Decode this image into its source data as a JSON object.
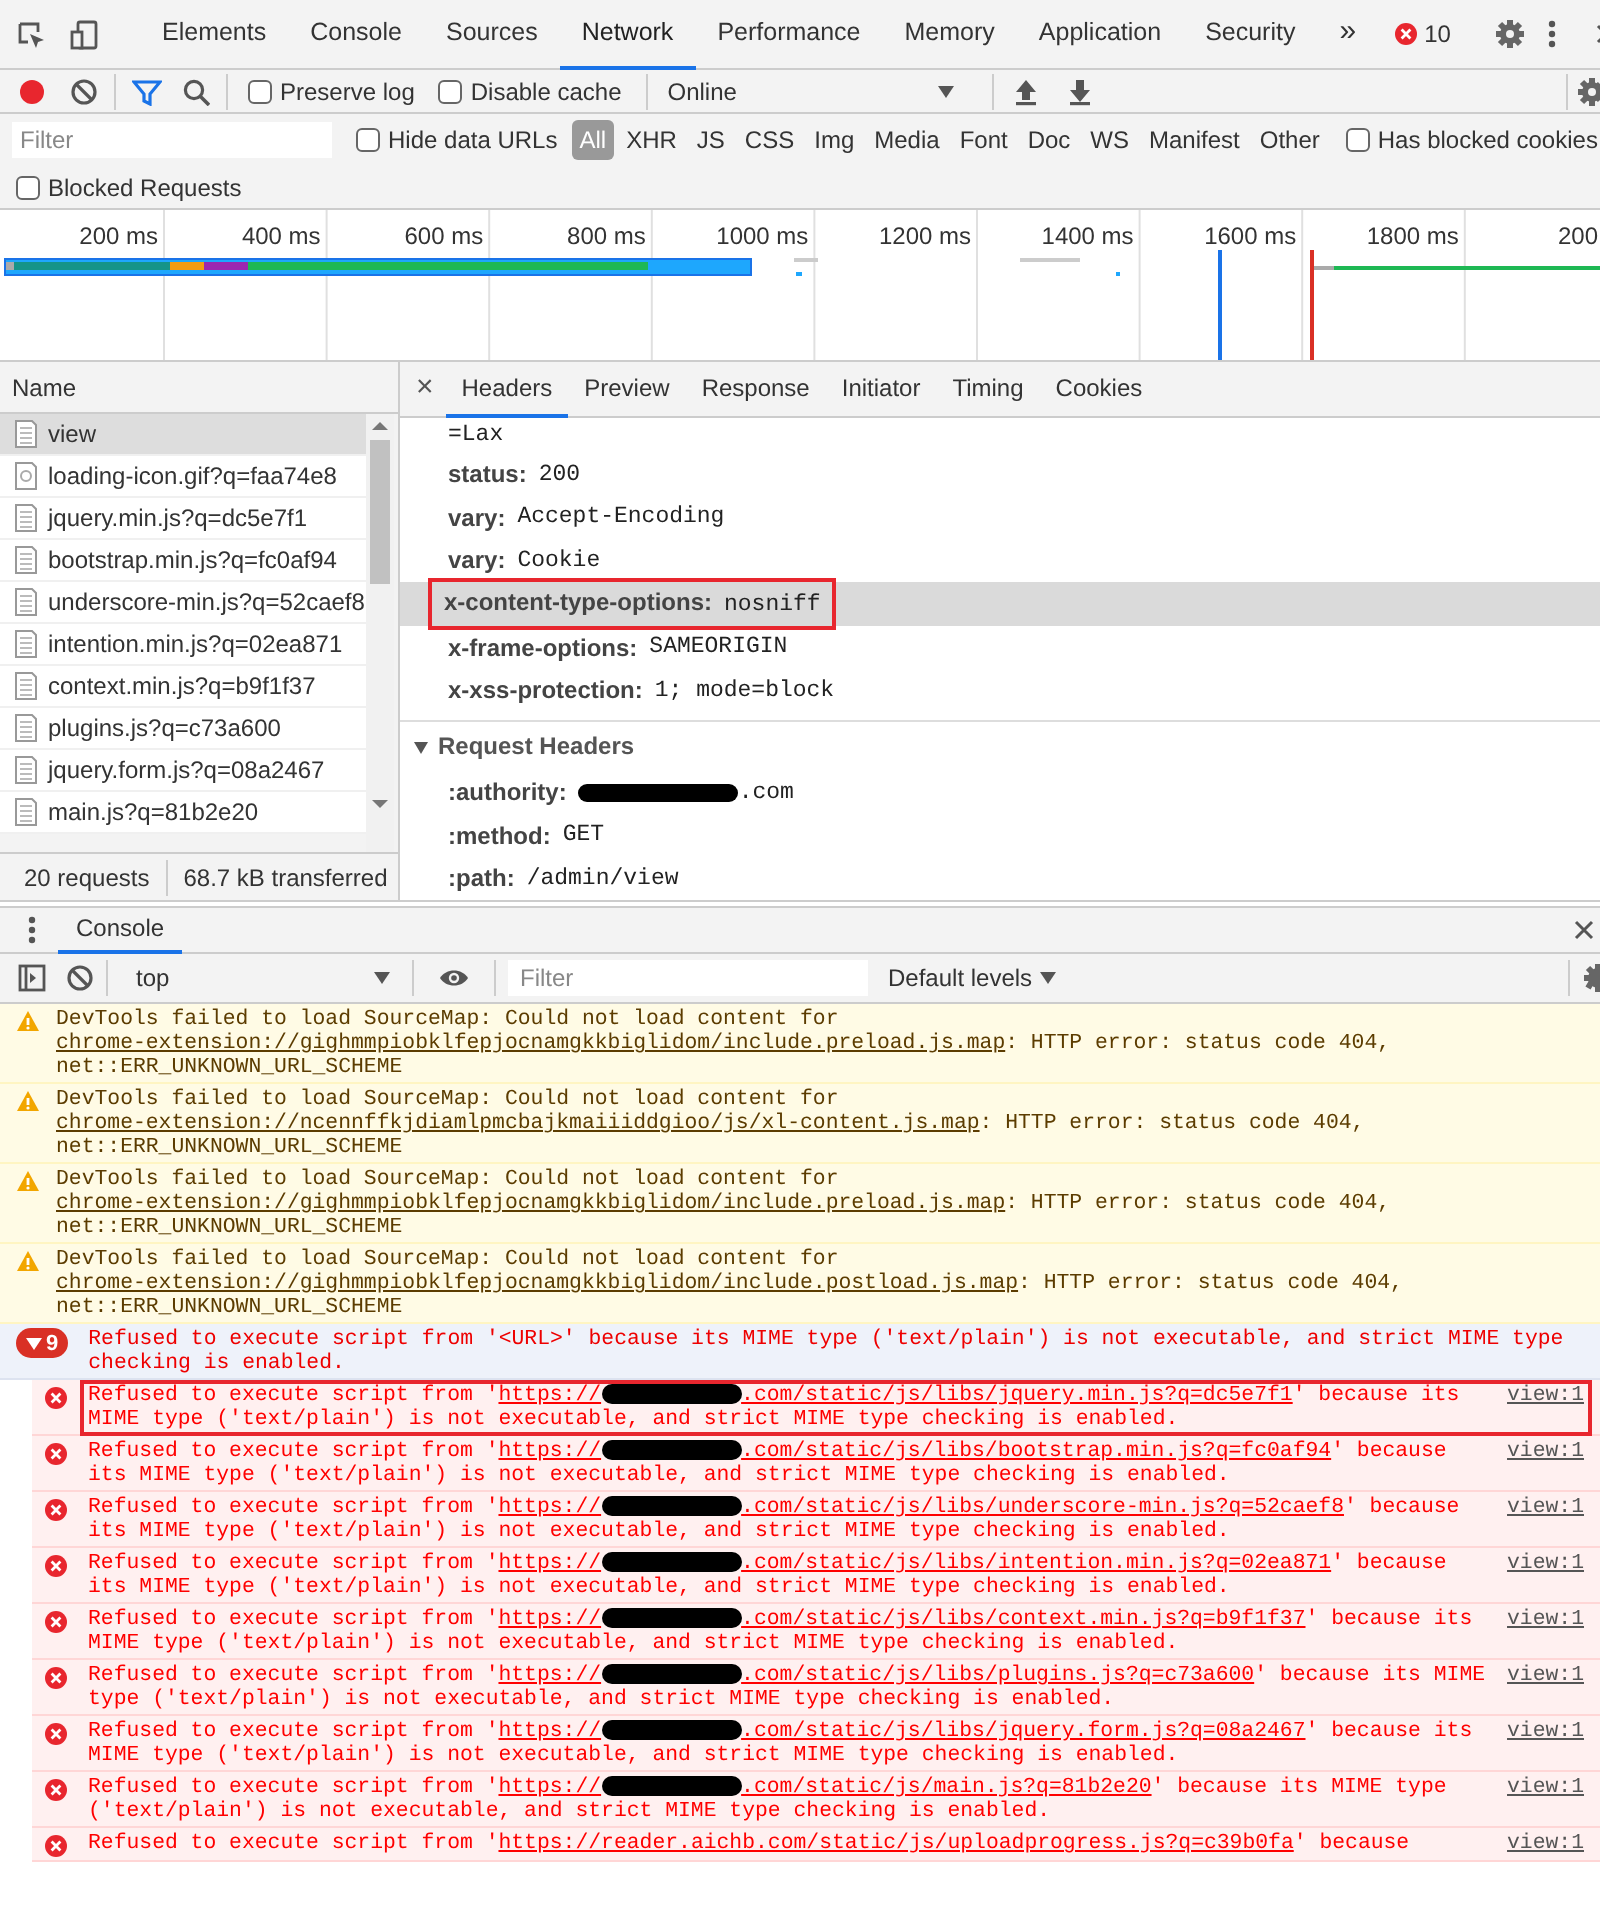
{
  "tabs": [
    {
      "label": "Elements",
      "selected": false
    },
    {
      "label": "Console",
      "selected": false
    },
    {
      "label": "Sources",
      "selected": false
    },
    {
      "label": "Network",
      "selected": true
    },
    {
      "label": "Performance",
      "selected": false
    },
    {
      "label": "Memory",
      "selected": false
    },
    {
      "label": "Application",
      "selected": false
    },
    {
      "label": "Security",
      "selected": false
    }
  ],
  "overflow": "»",
  "error_count": "10",
  "network_toolbar": {
    "recording": true,
    "preserve_log": {
      "label": "Preserve log",
      "checked": false
    },
    "disable_cache": {
      "label": "Disable cache",
      "checked": false
    },
    "throttling": "Online"
  },
  "filter_bar": {
    "placeholder": "Filter",
    "hide_data_urls": {
      "label": "Hide data URLs",
      "checked": false
    },
    "types": [
      {
        "label": "All",
        "selected": true
      },
      {
        "label": "XHR",
        "selected": false
      },
      {
        "label": "JS",
        "selected": false
      },
      {
        "label": "CSS",
        "selected": false
      },
      {
        "label": "Img",
        "selected": false
      },
      {
        "label": "Media",
        "selected": false
      },
      {
        "label": "Font",
        "selected": false
      },
      {
        "label": "Doc",
        "selected": false
      },
      {
        "label": "WS",
        "selected": false
      },
      {
        "label": "Manifest",
        "selected": false
      },
      {
        "label": "Other",
        "selected": false
      }
    ],
    "has_blocked_cookies": {
      "label": "Has blocked cookies",
      "checked": false
    },
    "blocked_requests": {
      "label": "Blocked Requests",
      "checked": false
    }
  },
  "timeline": {
    "ticks": [
      "200 ms",
      "400 ms",
      "600 ms",
      "800 ms",
      "1000 ms",
      "1200 ms",
      "1400 ms",
      "1600 ms",
      "1800 ms",
      "200"
    ]
  },
  "requests": {
    "column": "Name",
    "items": [
      {
        "name": "view",
        "kind": "document",
        "selected": true
      },
      {
        "name": "loading-icon.gif?q=faa74e8",
        "kind": "image",
        "selected": false
      },
      {
        "name": "jquery.min.js?q=dc5e7f1",
        "kind": "document",
        "selected": false
      },
      {
        "name": "bootstrap.min.js?q=fc0af94",
        "kind": "document",
        "selected": false
      },
      {
        "name": "underscore-min.js?q=52caef8",
        "kind": "document",
        "selected": false
      },
      {
        "name": "intention.min.js?q=02ea871",
        "kind": "document",
        "selected": false
      },
      {
        "name": "context.min.js?q=b9f1f37",
        "kind": "document",
        "selected": false
      },
      {
        "name": "plugins.js?q=c73a600",
        "kind": "document",
        "selected": false
      },
      {
        "name": "jquery.form.js?q=08a2467",
        "kind": "document",
        "selected": false
      },
      {
        "name": "main.js?q=81b2e20",
        "kind": "document",
        "selected": false
      }
    ],
    "summary": [
      "20 requests",
      "68.7 kB transferred"
    ]
  },
  "details": {
    "close": "×",
    "tabs": [
      {
        "label": "Headers",
        "selected": true
      },
      {
        "label": "Preview",
        "selected": false
      },
      {
        "label": "Response",
        "selected": false
      },
      {
        "label": "Initiator",
        "selected": false
      },
      {
        "label": "Timing",
        "selected": false
      },
      {
        "label": "Cookies",
        "selected": false
      }
    ],
    "response_lines": [
      {
        "kind": "continuation",
        "value": "=Lax",
        "highlighted": false
      },
      {
        "kind": "header",
        "name": "status:",
        "value": "200",
        "highlighted": false
      },
      {
        "kind": "header",
        "name": "vary:",
        "value": "Accept-Encoding",
        "highlighted": false
      },
      {
        "kind": "header",
        "name": "vary:",
        "value": "Cookie",
        "highlighted": false
      },
      {
        "kind": "header",
        "name": "x-content-type-options:",
        "value": "nosniff",
        "highlighted": true
      },
      {
        "kind": "header",
        "name": "x-frame-options:",
        "value": "SAMEORIGIN",
        "highlighted": false
      },
      {
        "kind": "header",
        "name": "x-xss-protection:",
        "value": "1; mode=block",
        "highlighted": false
      }
    ],
    "request_section": {
      "title": "Request Headers",
      "expanded": true,
      "lines": [
        {
          "name": ":authority:",
          "value": ".com",
          "redacted": true
        },
        {
          "name": ":method:",
          "value": "GET",
          "redacted": false
        },
        {
          "name": ":path:",
          "value": "/admin/view",
          "redacted": false
        }
      ]
    }
  },
  "drawer": {
    "tabs": [
      {
        "label": "Console",
        "selected": true
      }
    ]
  },
  "console_toolbar": {
    "context": "top",
    "filter_placeholder": "Filter",
    "levels": "Default levels"
  },
  "messages": [
    {
      "kind": "warning",
      "text": "DevTools failed to load SourceMap: Could not load content for ",
      "link": "chrome-extension://gighmmpiobklfepjocnamgkkbiglidom/include.preload.js.map",
      "after": ": HTTP error: status code 404, net::ERR_UNKNOWN_URL_SCHEME"
    },
    {
      "kind": "warning",
      "text": "DevTools failed to load SourceMap: Could not load content for ",
      "link": "chrome-extension://ncennffkjdiamlpmcbajkmaiiiddgioo/js/xl-content.js.map",
      "after": ": HTTP error: status code 404, net::ERR_UNKNOWN_URL_SCHEME"
    },
    {
      "kind": "warning",
      "text": "DevTools failed to load SourceMap: Could not load content for ",
      "link": "chrome-extension://gighmmpiobklfepjocnamgkkbiglidom/include.preload.js.map",
      "after": ": HTTP error: status code 404, net::ERR_UNKNOWN_URL_SCHEME"
    },
    {
      "kind": "warning",
      "text": "DevTools failed to load SourceMap: Could not load content for ",
      "link": "chrome-extension://gighmmpiobklfepjocnamgkkbiglidom/include.postload.js.map",
      "after": ": HTTP error: status code 404, net::ERR_UNKNOWN_URL_SCHEME"
    },
    {
      "kind": "group",
      "count": "9",
      "expanded": true,
      "text": "Refused to execute script from '<URL>' because its MIME type ('text/plain') is not executable, and strict MIME type checking is enabled."
    },
    {
      "kind": "error",
      "text": "Refused to execute script from '",
      "url_parts": [
        "https://",
        ".com/static/js/libs/jquery.min.js?q=dc5e7f1"
      ],
      "after": "' because its MIME type ('text/plain') is not executable, and strict MIME type checking is enabled.",
      "source": "view:1",
      "highlighted": true
    },
    {
      "kind": "error",
      "text": "Refused to execute script from '",
      "url_parts": [
        "https://",
        ".com/static/js/libs/bootstrap.min.js?q=fc0af94"
      ],
      "after": "' because its MIME type ('text/plain') is not executable, and strict MIME type checking is enabled.",
      "source": "view:1",
      "highlighted": false
    },
    {
      "kind": "error",
      "text": "Refused to execute script from '",
      "url_parts": [
        "https://",
        ".com/static/js/libs/underscore-min.js?q=52caef8"
      ],
      "after": "' because its MIME type ('text/plain') is not executable, and strict MIME type checking is enabled.",
      "source": "view:1",
      "highlighted": false
    },
    {
      "kind": "error",
      "text": "Refused to execute script from '",
      "url_parts": [
        "https://",
        ".com/static/js/libs/intention.min.js?q=02ea871"
      ],
      "after": "' because its MIME type ('text/plain') is not executable, and strict MIME type checking is enabled.",
      "source": "view:1",
      "highlighted": false
    },
    {
      "kind": "error",
      "text": "Refused to execute script from '",
      "url_parts": [
        "https://",
        ".com/static/js/libs/context.min.js?q=b9f1f37"
      ],
      "after": "' because its MIME type ('text/plain') is not executable, and strict MIME type checking is enabled.",
      "source": "view:1",
      "highlighted": false
    },
    {
      "kind": "error",
      "text": "Refused to execute script from '",
      "url_parts": [
        "https://",
        ".com/static/js/libs/plugins.js?q=c73a600"
      ],
      "after": "' because its MIME type ('text/plain') is not executable, and strict MIME type checking is enabled.",
      "source": "view:1",
      "highlighted": false
    },
    {
      "kind": "error",
      "text": "Refused to execute script from '",
      "url_parts": [
        "https://",
        ".com/static/js/libs/jquery.form.js?q=08a2467"
      ],
      "after": "' because its MIME type ('text/plain') is not executable, and strict MIME type checking is enabled.",
      "source": "view:1",
      "highlighted": false
    },
    {
      "kind": "error",
      "text": "Refused to execute script from '",
      "url_parts": [
        "https://",
        ".com/static/js/main.js?q=81b2e20"
      ],
      "after": "' because its MIME type ('text/plain') is not executable, and strict MIME type checking is enabled.",
      "source": "view:1",
      "highlighted": false
    },
    {
      "kind": "error",
      "text": "Refused to execute script from '",
      "url_parts": [
        "https://reader.aichb.com/static/js/uploadprogress.js?q=c39b0fa"
      ],
      "after": "' because",
      "source": "view:1",
      "highlighted": false
    }
  ]
}
